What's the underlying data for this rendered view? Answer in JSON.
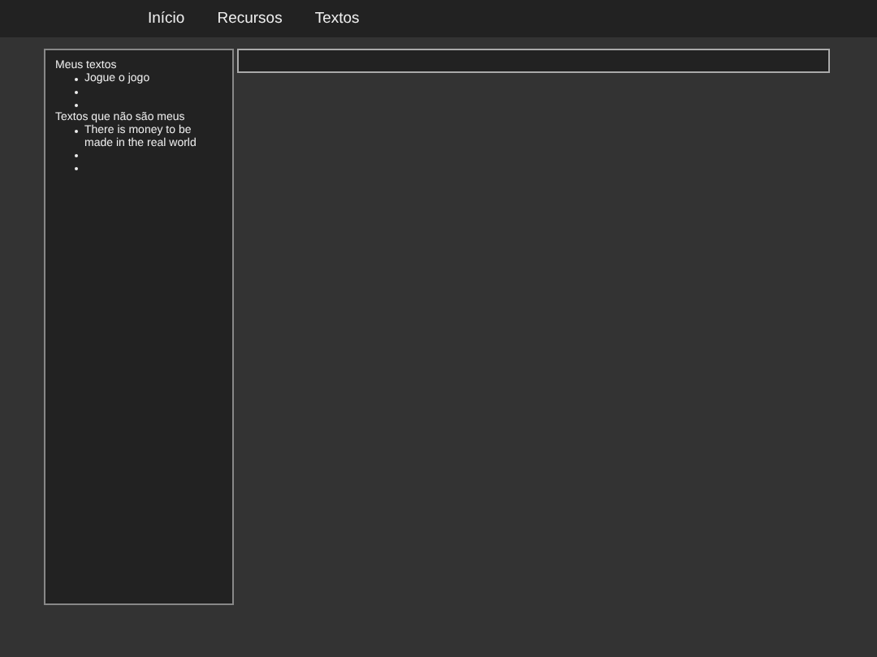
{
  "nav": {
    "links": [
      {
        "label": "Início"
      },
      {
        "label": "Recursos"
      },
      {
        "label": "Textos"
      }
    ]
  },
  "sidebar": {
    "sections": [
      {
        "heading": "Meus textos",
        "items": [
          {
            "kind": "link",
            "text": "Jogue o jogo"
          },
          {
            "kind": "empty"
          },
          {
            "kind": "empty"
          }
        ]
      },
      {
        "heading": "Textos que não são meus",
        "items": [
          {
            "kind": "link",
            "text": "There is money to be made in the real world"
          },
          {
            "kind": "empty"
          },
          {
            "kind": "empty"
          }
        ]
      }
    ]
  }
}
